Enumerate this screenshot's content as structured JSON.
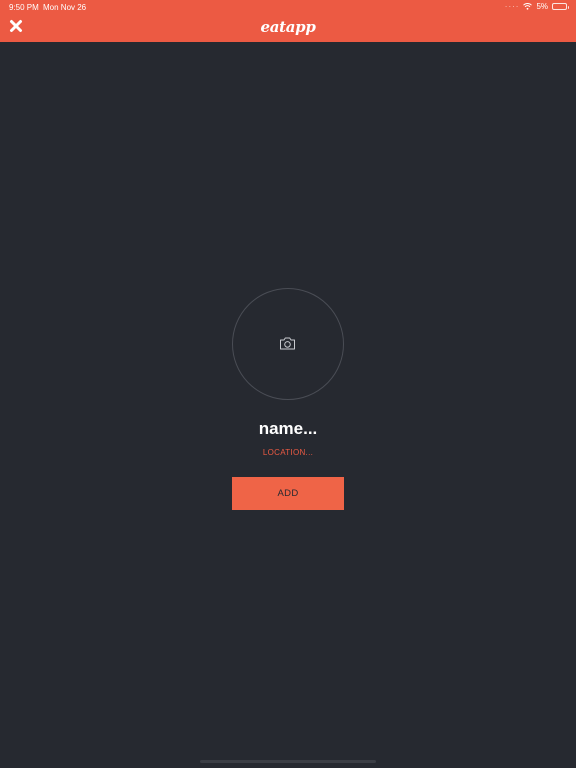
{
  "status_bar": {
    "time": "9:50 PM",
    "date": "Mon Nov 26",
    "battery": "5%"
  },
  "header": {
    "logo": "eatapp",
    "close_icon": "close-icon",
    "background": "#ec5a43"
  },
  "profile": {
    "camera_icon": "camera-icon",
    "name_placeholder": "name...",
    "location_placeholder": "LOCATION..."
  },
  "actions": {
    "add_label": "ADD",
    "accent": "#ef6447"
  },
  "theme": {
    "background": "#262930",
    "text": "#ffffff"
  }
}
